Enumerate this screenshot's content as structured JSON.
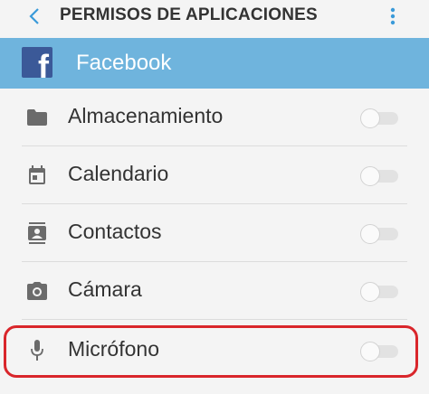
{
  "header": {
    "back_icon": "chevron-left-icon",
    "title": "PERMISOS DE APLICACIONES",
    "menu_icon": "more-vertical-icon"
  },
  "app": {
    "name": "Facebook",
    "logo_letter": "f",
    "bar_color": "#6fb4dd",
    "logo_color": "#3b5998"
  },
  "permissions": [
    {
      "label": "Almacenamiento",
      "icon": "folder-icon",
      "enabled": false
    },
    {
      "label": "Calendario",
      "icon": "calendar-icon",
      "enabled": false
    },
    {
      "label": "Contactos",
      "icon": "contacts-icon",
      "enabled": false
    },
    {
      "label": "Cámara",
      "icon": "camera-icon",
      "enabled": false
    },
    {
      "label": "Micrófono",
      "icon": "microphone-icon",
      "enabled": false
    }
  ],
  "highlight_color": "#d9262b"
}
